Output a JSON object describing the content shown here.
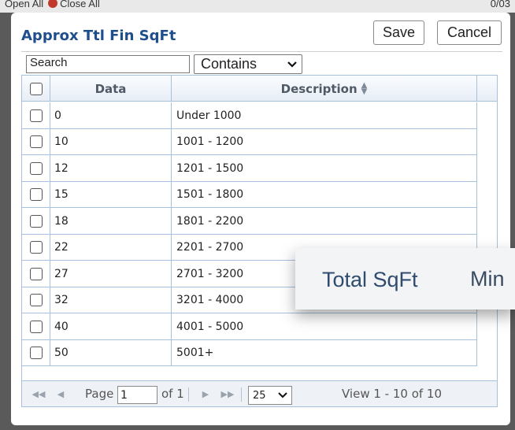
{
  "backdrop": {
    "left_text": "Open All",
    "close_text": "Close All",
    "right_text": "0/03"
  },
  "dialog": {
    "title": "Approx Ttl Fin SqFt",
    "save_label": "Save",
    "cancel_label": "Cancel"
  },
  "search": {
    "value": "Search",
    "mode": "Contains"
  },
  "grid": {
    "headers": {
      "data": "Data",
      "description": "Description"
    },
    "rows": [
      {
        "data": "0",
        "description": "Under 1000"
      },
      {
        "data": "10",
        "description": "1001 - 1200"
      },
      {
        "data": "12",
        "description": "1201 - 1500"
      },
      {
        "data": "15",
        "description": "1501 - 1800"
      },
      {
        "data": "18",
        "description": "1801 - 2200"
      },
      {
        "data": "22",
        "description": "2201 - 2700"
      },
      {
        "data": "27",
        "description": "2701 - 3200"
      },
      {
        "data": "32",
        "description": "3201 - 4000"
      },
      {
        "data": "40",
        "description": "4001 - 5000"
      },
      {
        "data": "50",
        "description": "5001+"
      }
    ]
  },
  "pager": {
    "page_label": "Page",
    "page_value": "1",
    "of_label": "of 1",
    "rows_per_page": "25",
    "view_label": "View 1 - 10 of 10"
  },
  "tooltip": {
    "primary": "Total SqFt",
    "secondary": "Min"
  }
}
